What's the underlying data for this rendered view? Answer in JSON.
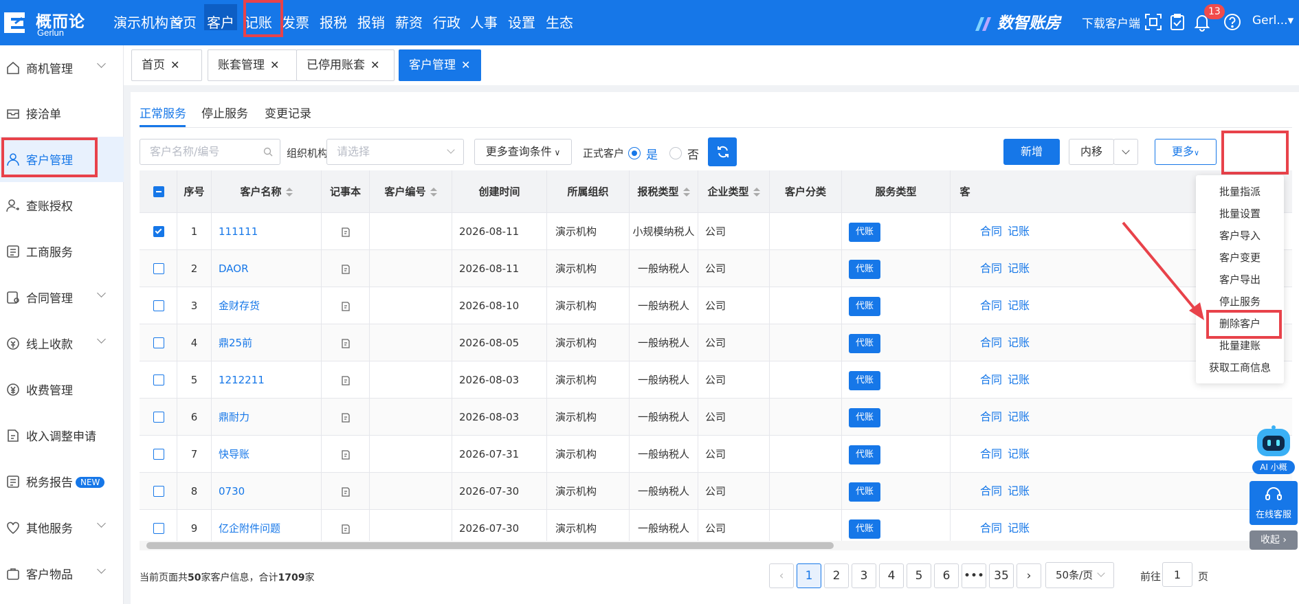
{
  "app": {
    "logo_cn": "概而论",
    "logo_en": "Gerlun",
    "org": "演示机构",
    "nav": [
      "首页",
      "客户",
      "记账",
      "发票",
      "报税",
      "报销",
      "薪资",
      "行政",
      "人事",
      "设置",
      "生态"
    ],
    "active_nav": "客户",
    "brand": "数智账房",
    "download": "下载客户端",
    "notification_count": "13",
    "user": "Gerl..."
  },
  "sidebar": {
    "items": [
      {
        "label": "商机管理",
        "icon": "home-icon",
        "expand": true
      },
      {
        "label": "接洽单",
        "icon": "inbox-icon",
        "expand": false
      },
      {
        "label": "客户管理",
        "icon": "user-icon",
        "expand": false,
        "active": true
      },
      {
        "label": "查账授权",
        "icon": "user-key-icon",
        "expand": false
      },
      {
        "label": "工商服务",
        "icon": "list-icon",
        "expand": false
      },
      {
        "label": "合同管理",
        "icon": "contract-icon",
        "expand": true
      },
      {
        "label": "线上收款",
        "icon": "coin-icon",
        "expand": true
      },
      {
        "label": "收费管理",
        "icon": "yen-icon",
        "expand": false
      },
      {
        "label": "收入调整申请",
        "icon": "doc-edit-icon",
        "expand": false
      },
      {
        "label": "税务报告",
        "icon": "report-icon",
        "expand": false,
        "badge": "NEW"
      },
      {
        "label": "其他服务",
        "icon": "heart-icon",
        "expand": true
      },
      {
        "label": "客户物品",
        "icon": "box-icon",
        "expand": true
      }
    ]
  },
  "page_tabs": [
    "首页",
    "账套管理",
    "已停用账套",
    "客户管理"
  ],
  "active_page_tab": "客户管理",
  "sub_tabs": [
    "正常服务",
    "停止服务",
    "变更记录"
  ],
  "filters": {
    "search_placeholder": "客户名称/编号",
    "org_label": "组织机构",
    "org_placeholder": "请选择",
    "more_conditions": "更多查询条件",
    "formal_label": "正式客户",
    "yes": "是",
    "no": "否"
  },
  "actions": {
    "add": "新增",
    "move": "内移",
    "more": "更多"
  },
  "table": {
    "headers": [
      "序号",
      "客户名称",
      "记事本",
      "客户编号",
      "创建时间",
      "所属组织",
      "报税类型",
      "企业类型",
      "客户分类",
      "服务类型",
      "客"
    ],
    "rows": [
      {
        "no": "1",
        "name": "111111",
        "code": "",
        "created": "2026-08-11",
        "org": "演示机构",
        "tax": "小规模纳税人",
        "type": "公司",
        "service": "代账",
        "checked": true
      },
      {
        "no": "2",
        "name": "DAOR",
        "code": "",
        "created": "2026-08-11",
        "org": "演示机构",
        "tax": "一般纳税人",
        "type": "公司",
        "service": "代账",
        "checked": false
      },
      {
        "no": "3",
        "name": "金财存货",
        "code": "",
        "created": "2026-08-10",
        "org": "演示机构",
        "tax": "一般纳税人",
        "type": "公司",
        "service": "代账",
        "checked": false
      },
      {
        "no": "4",
        "name": "鼎25前",
        "code": "",
        "created": "2026-08-05",
        "org": "演示机构",
        "tax": "一般纳税人",
        "type": "公司",
        "service": "代账",
        "checked": false
      },
      {
        "no": "5",
        "name": "1212211",
        "code": "",
        "created": "2026-08-03",
        "org": "演示机构",
        "tax": "一般纳税人",
        "type": "公司",
        "service": "代账",
        "checked": false
      },
      {
        "no": "6",
        "name": "鼎耐力",
        "code": "",
        "created": "2026-08-03",
        "org": "演示机构",
        "tax": "一般纳税人",
        "type": "公司",
        "service": "代账",
        "checked": false
      },
      {
        "no": "7",
        "name": "快导账",
        "code": "",
        "created": "2026-07-31",
        "org": "演示机构",
        "tax": "一般纳税人",
        "type": "公司",
        "service": "代账",
        "checked": false
      },
      {
        "no": "8",
        "name": "0730",
        "code": "",
        "created": "2026-07-30",
        "org": "演示机构",
        "tax": "一般纳税人",
        "type": "公司",
        "service": "代账",
        "checked": false
      },
      {
        "no": "9",
        "name": "亿企附件问题",
        "code": "",
        "created": "2026-07-30",
        "org": "演示机构",
        "tax": "一般纳税人",
        "type": "公司",
        "service": "代账",
        "checked": false
      }
    ],
    "row_actions": [
      "合同",
      "记账"
    ]
  },
  "more_menu": [
    "批量指派",
    "批量设置",
    "客户导入",
    "客户变更",
    "客户导出",
    "停止服务",
    "删除客户",
    "批量建账",
    "获取工商信息"
  ],
  "highlight_menu": "删除客户",
  "footer": {
    "prefix": "当前页面共",
    "page_count": "50",
    "middle": "家客户信息，合计",
    "total": "1709",
    "suffix": "家",
    "pages": [
      "1",
      "2",
      "3",
      "4",
      "5",
      "6",
      "•••",
      "35"
    ],
    "per_page": "50条/页",
    "goto_label": "前往",
    "goto_value": "1",
    "page_suffix": "页"
  },
  "floating": {
    "ai": "AI 小概",
    "service": "在线客服",
    "collapse": "收起"
  },
  "colors": {
    "primary": "#1677e8",
    "highlight": "#e8424a",
    "active_nav_bg": "#0d5ec4"
  }
}
